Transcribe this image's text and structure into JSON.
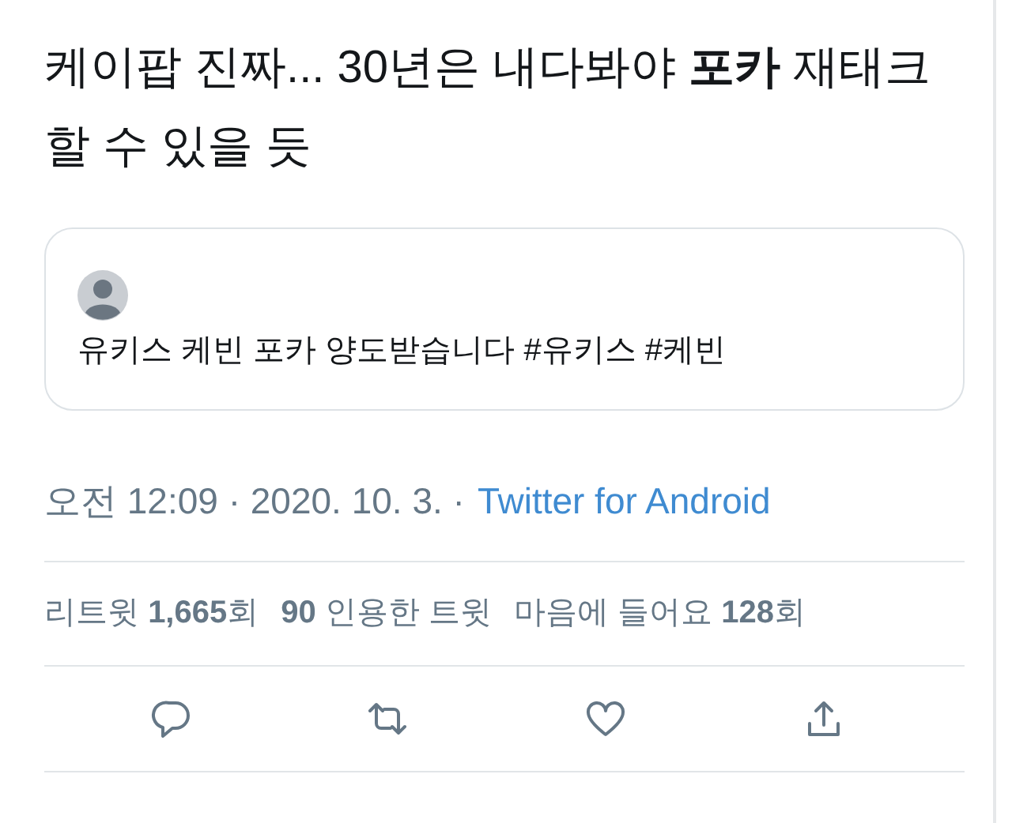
{
  "tweet": {
    "text": "케이팝 진짜... 30년은 내다봐야 **포카** 재태크 할 수 있을 듯"
  },
  "quote": {
    "text": "유키스 케빈 포카 양도받습니다 #유키스 #케빈"
  },
  "meta": {
    "time": "오전 12:09 · 2020. 10. 3. ·",
    "source": "Twitter for Android"
  },
  "stats": [
    "리트윗 **1,665**회",
    "**90** 인용한 트윗",
    "마음에 들어요 **128**회"
  ],
  "actions": [
    {
      "kind": "reply"
    },
    {
      "kind": "retweet"
    },
    {
      "kind": "like"
    },
    {
      "kind": "share"
    }
  ]
}
